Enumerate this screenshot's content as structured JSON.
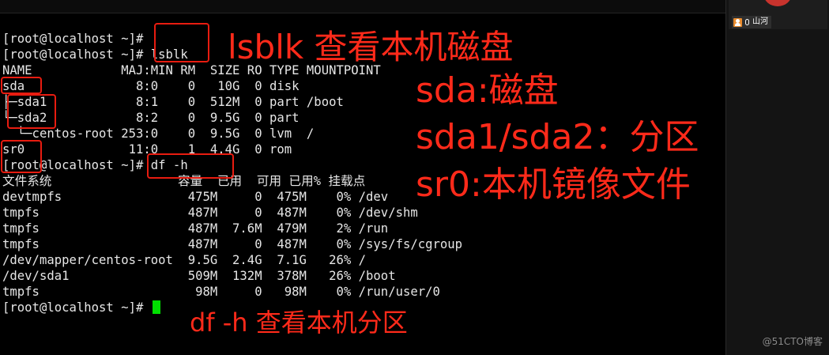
{
  "terminal": {
    "lines": [
      "[root@localhost ~]#",
      "[root@localhost ~]# lsblk",
      "NAME            MAJ:MIN RM  SIZE RO TYPE MOUNTPOINT",
      "sda               8:0    0   10G  0 disk",
      "├─sda1            8:1    0  512M  0 part /boot",
      "└─sda2            8:2    0  9.5G  0 part",
      "  └─centos-root 253:0    0  9.5G  0 lvm  /",
      "sr0              11:0    1  4.4G  0 rom",
      "[root@localhost ~]# df -h",
      "文件系统                 容量  已用  可用 已用% 挂载点",
      "devtmpfs                 475M     0  475M    0% /dev",
      "tmpfs                    487M     0  487M    0% /dev/shm",
      "tmpfs                    487M  7.6M  479M    2% /run",
      "tmpfs                    487M     0  487M    0% /sys/fs/cgroup",
      "/dev/mapper/centos-root  9.5G  2.4G  7.1G   26% /",
      "/dev/sda1                509M  132M  378M   26% /boot",
      "tmpfs                     98M     0   98M    0% /run/user/0",
      "[root@localhost ~]# "
    ],
    "colors": {
      "text": "#e6e6e6",
      "cursor": "#00e000",
      "background": "#000000"
    }
  },
  "annotations": {
    "lsblk_note": "lsblk 查看本机磁盘",
    "sda_note": "sda:磁盘",
    "partition_note": "sda1/sda2：分区",
    "sr0_note": "sr0:本机镜像文件",
    "dfh_note": "df -h 查看本机分区",
    "color": "#ff2a1a"
  },
  "side_panel": {
    "participant_name": "山河",
    "icons": [
      "person-icon",
      "microphone-icon"
    ]
  },
  "watermark": "@51CTO博客"
}
